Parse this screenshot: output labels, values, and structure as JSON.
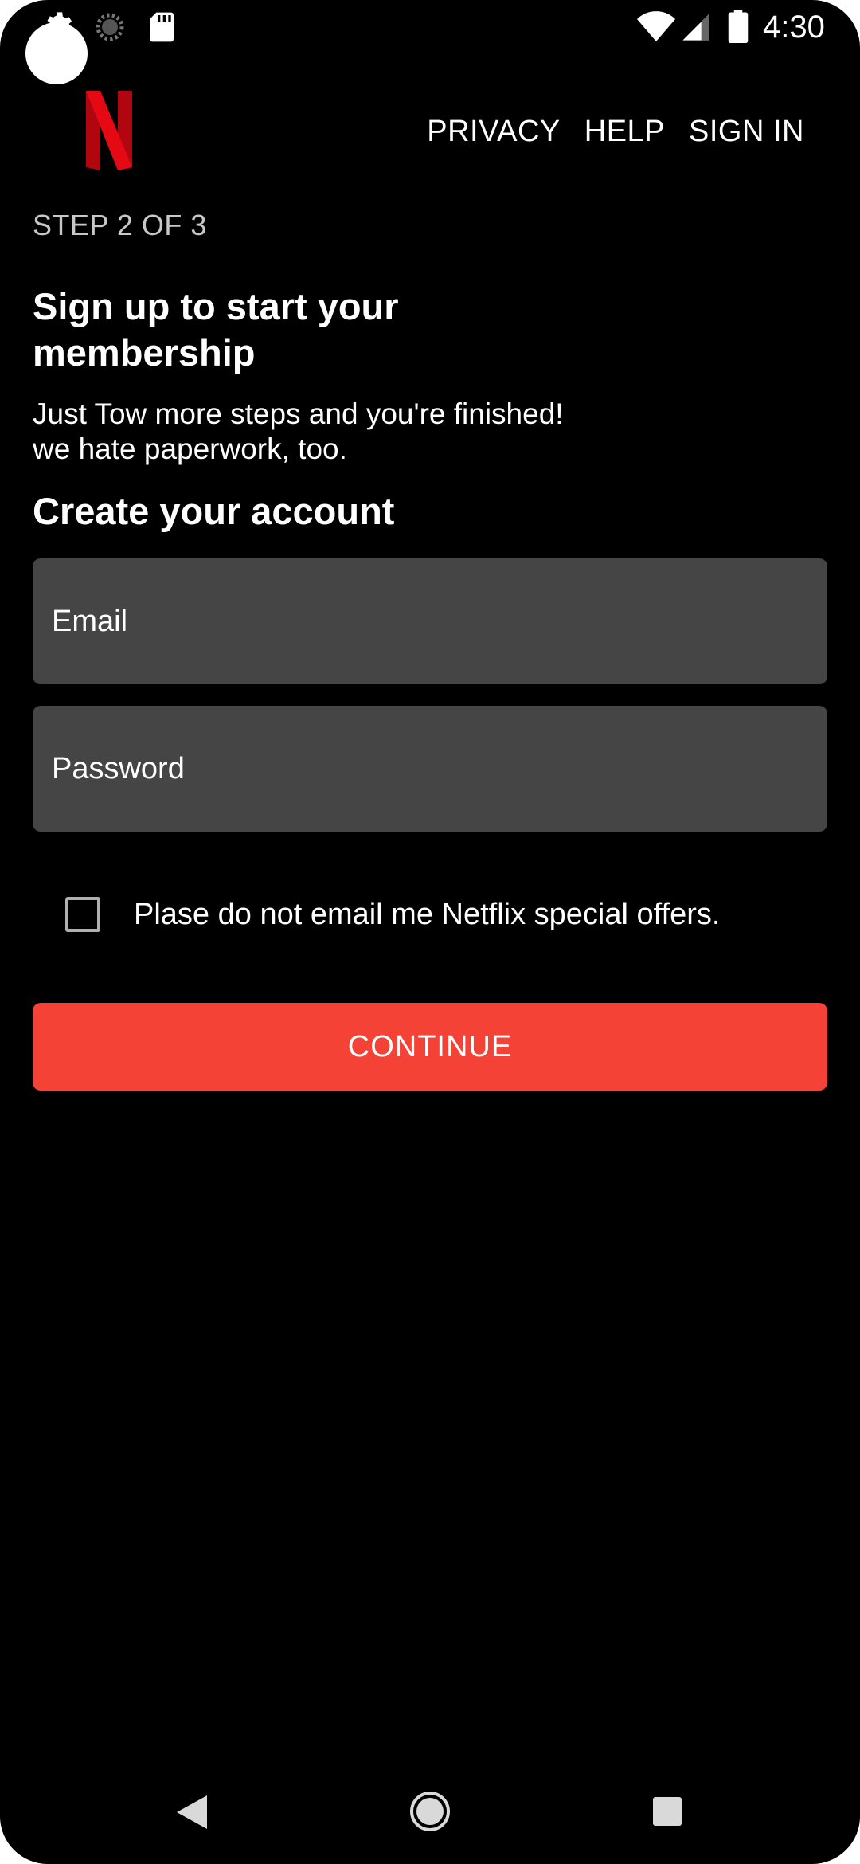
{
  "status_bar": {
    "time": "4:30",
    "icons": [
      "gear-icon",
      "spinner-icon",
      "sd-card-icon",
      "wifi-icon",
      "signal-icon",
      "battery-icon"
    ]
  },
  "header": {
    "logo": "N",
    "nav": {
      "privacy": "PRIVACY",
      "help": "HELP",
      "sign_in": "SIGN IN"
    }
  },
  "main": {
    "step": "STEP 2 OF 3",
    "heading": "Sign up to start your membership",
    "subtext_line1": "Just Tow more steps and you're finished!",
    "subtext_line2": "we hate paperwork, too.",
    "section_title": "Create your account",
    "email_placeholder": "Email",
    "password_placeholder": "Password",
    "checkbox_label": "Plase do not email me Netflix special offers.",
    "checkbox_checked": false,
    "continue_label": "CONTINUE"
  },
  "colors": {
    "background": "#000000",
    "field_bg": "#454545",
    "accent": "#f44336",
    "logo_red": "#e50914"
  }
}
